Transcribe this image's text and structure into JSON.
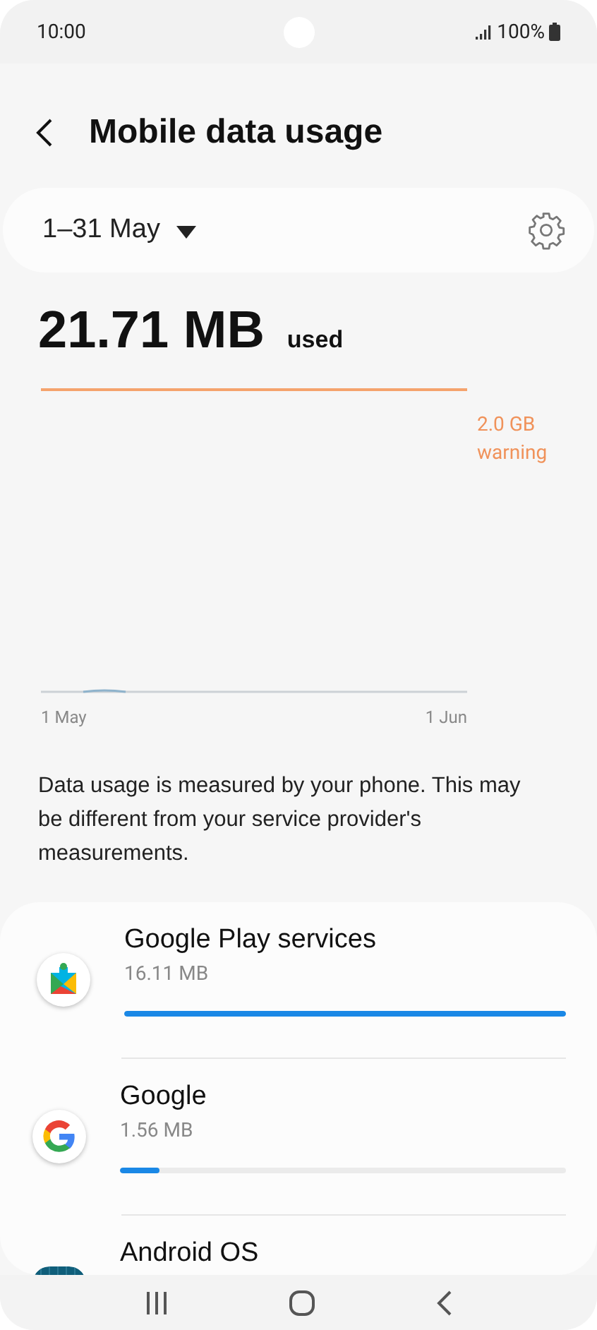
{
  "status_bar": {
    "time": "10:00",
    "battery": "100%"
  },
  "header": {
    "title": "Mobile data usage"
  },
  "period": {
    "label": "1–31 May"
  },
  "usage": {
    "amount": "21.71 MB",
    "unit_label": "used",
    "warning_label": "2.0 GB warning",
    "axis_start": "1 May",
    "axis_end": "1 Jun"
  },
  "note": "Data usage is measured by your phone. This may be different from your service provider's measurements.",
  "apps": [
    {
      "kind": "play_services",
      "name": "Google Play services",
      "size": "16.11 MB",
      "level": 1.0
    },
    {
      "kind": "google",
      "name": "Google",
      "size": "1.56 MB",
      "level": 0.09
    },
    {
      "kind": "android",
      "name": "Android OS"
    }
  ]
}
